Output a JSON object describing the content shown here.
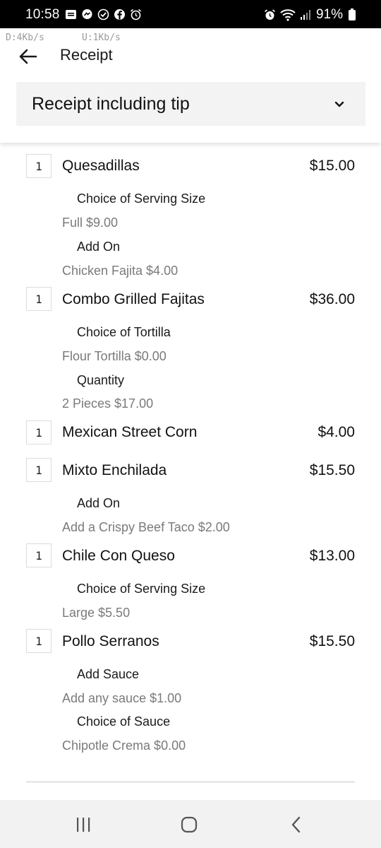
{
  "status_bar": {
    "time": "10:58",
    "battery": "91%",
    "left_icons": [
      "image-icon",
      "messenger-icon",
      "check-circle-icon",
      "facebook-icon",
      "alarm-icon"
    ],
    "right_icons": [
      "alarm-icon",
      "wifi-icon",
      "signal-icon",
      "battery-icon"
    ]
  },
  "net_speed": {
    "down": "D:4Kb/s",
    "up": "U:1Kb/s"
  },
  "header": {
    "title": "Receipt",
    "back_icon": "arrow-left-icon"
  },
  "dropdown": {
    "label": "Receipt including tip",
    "icon": "chevron-down-icon"
  },
  "items": [
    {
      "qty": "1",
      "name": "Quesadillas",
      "price": "$15.00",
      "options": [
        {
          "label": "Choice of Serving Size",
          "value": "Full $9.00"
        },
        {
          "label": "Add On",
          "value": "Chicken Fajita $4.00"
        }
      ]
    },
    {
      "qty": "1",
      "name": "Combo Grilled Fajitas",
      "price": "$36.00",
      "options": [
        {
          "label": "Choice of Tortilla",
          "value": "Flour Tortilla $0.00"
        },
        {
          "label": "Quantity",
          "value": "2 Pieces $17.00"
        }
      ]
    },
    {
      "qty": "1",
      "name": "Mexican Street Corn",
      "price": "$4.00",
      "options": []
    },
    {
      "qty": "1",
      "name": "Mixto Enchilada",
      "price": "$15.50",
      "options": [
        {
          "label": "Add On",
          "value": "Add a Crispy Beef Taco $2.00"
        }
      ]
    },
    {
      "qty": "1",
      "name": "Chile Con Queso",
      "price": "$13.00",
      "options": [
        {
          "label": "Choice of Serving Size",
          "value": "Large $5.50"
        }
      ]
    },
    {
      "qty": "1",
      "name": "Pollo Serranos",
      "price": "$15.50",
      "options": [
        {
          "label": "Add Sauce",
          "value": "Add any sauce $1.00"
        },
        {
          "label": "Choice of Sauce",
          "value": "Chipotle Crema $0.00"
        }
      ]
    }
  ],
  "nav_bar": {
    "icons": [
      "recent-apps-icon",
      "home-icon",
      "back-icon"
    ]
  }
}
